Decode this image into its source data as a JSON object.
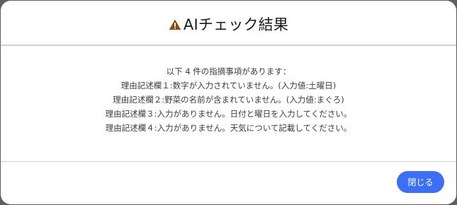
{
  "dialog": {
    "title": "AIチェック結果",
    "icon": "warning-icon",
    "icon_color": "#8a4b08",
    "messages": [
      "以下 4 件の指摘事項があります：",
      "理由記述欄１:数字が入力されていません。(入力値:土曜日)",
      "理由記述欄２:野菜の名前が含まれていません。(入力値:まぐろ)",
      "理由記述欄３:入力がありません。日付と曜日を入力してください。",
      "理由記述欄４:入力がありません。天気について記載してください。"
    ],
    "close_label": "閉じる",
    "button_color": "#3b6ff5"
  }
}
